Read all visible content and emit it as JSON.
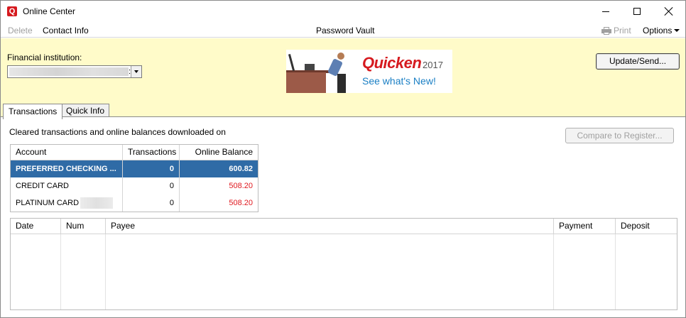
{
  "window": {
    "title": "Online Center",
    "app_icon_letter": "Q"
  },
  "menubar": {
    "delete_label": "Delete",
    "contact_label": "Contact Info",
    "vault_label": "Password Vault",
    "print_label": "Print",
    "options_label": "Options"
  },
  "header": {
    "fi_label": "Financial institution:",
    "fi_value_separator": ":",
    "banner": {
      "brand": "Quicken",
      "year": "2017",
      "tagline": "See what's New!"
    },
    "update_button": "Update/Send..."
  },
  "tabs": [
    {
      "label": "Transactions",
      "active": true
    },
    {
      "label": "Quick Info",
      "active": false
    }
  ],
  "panel": {
    "cleared_text": "Cleared transactions and online balances downloaded on",
    "compare_button": "Compare to Register..."
  },
  "accounts": {
    "headers": [
      "Account",
      "Transactions",
      "Online Balance"
    ],
    "rows": [
      {
        "account": "PREFERRED CHECKING ...",
        "transactions": "0",
        "balance": "600.82",
        "selected": true
      },
      {
        "account": "CREDIT CARD",
        "transactions": "0",
        "balance": "508.20",
        "selected": false
      },
      {
        "account": "PLATINUM CARD",
        "transactions": "0",
        "balance": "508.20",
        "selected": false
      }
    ]
  },
  "transactions": {
    "headers": [
      "Date",
      "Num",
      "Payee",
      "Payment",
      "Deposit"
    ]
  },
  "colors": {
    "header_bg": "#fffbc9",
    "selection": "#2f6ba6",
    "negative": "#e0191f",
    "brand_red": "#d61a1f",
    "brand_blue": "#1a7fc4"
  },
  "icons": [
    "quicken-app-icon",
    "minimize-icon",
    "maximize-icon",
    "close-icon",
    "printer-icon",
    "chevron-down-icon",
    "dropdown-arrow-icon"
  ]
}
